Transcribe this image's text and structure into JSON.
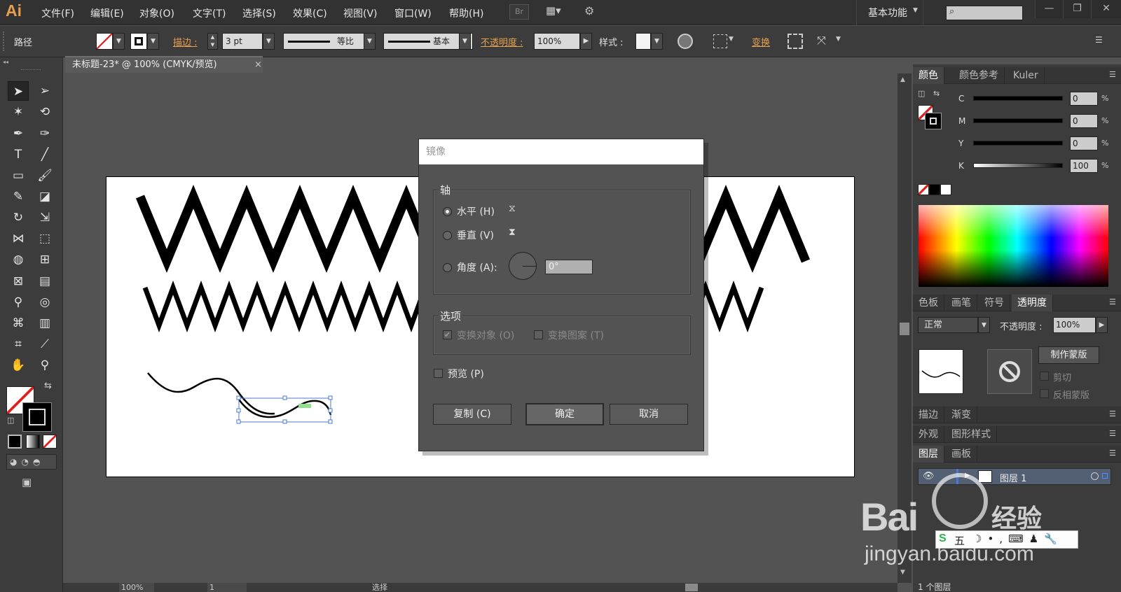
{
  "app": {
    "logo": "Ai",
    "menus": [
      "文件(F)",
      "编辑(E)",
      "对象(O)",
      "文字(T)",
      "选择(S)",
      "效果(C)",
      "视图(V)",
      "窗口(W)",
      "帮助(H)"
    ],
    "bridge_label": "Br",
    "workspace": "基本功能",
    "window_min": "—",
    "window_max": "❐",
    "window_close": "✕"
  },
  "control_bar": {
    "selection_type": "路径",
    "stroke_label": "描边 :",
    "stroke_weight": "3 pt",
    "profile_label": "等比",
    "brush_label": "基本",
    "opacity_label": "不透明度 :",
    "opacity_value": "100%",
    "style_label": "样式 :",
    "transform_label": "变换"
  },
  "document": {
    "tab_title": "未标题-23* @ 100% (CMYK/预览)",
    "tab_close": "×",
    "zoom": "100%",
    "page": "1",
    "status_tool": "选择"
  },
  "dialog": {
    "title": "镜像",
    "axis_group": "轴",
    "horizontal_label": "水平 (H)",
    "vertical_label": "垂直 (V)",
    "angle_label": "角度 (A):",
    "angle_value": "0°",
    "selected_axis": "horizontal",
    "options_group": "选项",
    "transform_objects": "变换对象 (O)",
    "transform_patterns": "变换图案 (T)",
    "preview": "预览 (P)",
    "copy_button": "复制 (C)",
    "ok_button": "确定",
    "cancel_button": "取消"
  },
  "color_panel": {
    "tabs": [
      "颜色",
      "颜色参考",
      "Kuler"
    ],
    "channels": [
      {
        "label": "C",
        "value": "0",
        "unit": "%"
      },
      {
        "label": "M",
        "value": "0",
        "unit": "%"
      },
      {
        "label": "Y",
        "value": "0",
        "unit": "%"
      },
      {
        "label": "K",
        "value": "100",
        "unit": "%"
      }
    ]
  },
  "transparency_panel": {
    "tabs": [
      "色板",
      "画笔",
      "符号",
      "透明度"
    ],
    "blend_mode": "正常",
    "opacity_label": "不透明度 :",
    "opacity_value": "100%",
    "make_mask_button": "制作蒙版",
    "clip_label": "剪切",
    "invert_label": "反相蒙版"
  },
  "stroke_panel": {
    "tabs": [
      "描边",
      "渐变"
    ]
  },
  "appearance_panel": {
    "tabs": [
      "外观",
      "图形样式"
    ]
  },
  "layers_panel": {
    "tabs": [
      "图层",
      "画板"
    ],
    "layer_name": "图层 1",
    "footer": "1 个图层"
  },
  "watermark": {
    "brand": "Bai",
    "brand_cn": "经验",
    "url": "jingyan.baidu.com",
    "ime_text": "五"
  },
  "colors": {
    "accent_orange": "#e8a04e",
    "ui_dark": "#323232",
    "selection_blue": "#4a78d4"
  }
}
